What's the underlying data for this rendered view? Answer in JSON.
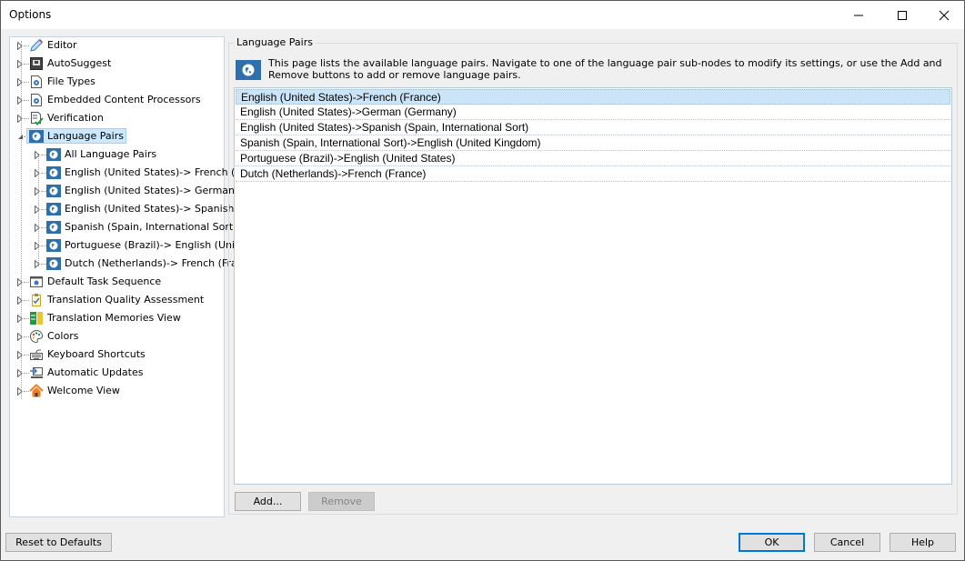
{
  "window": {
    "title": "Options",
    "controls": {
      "minimize": "minimize",
      "maximize": "maximize",
      "close": "close"
    }
  },
  "tree": {
    "items": [
      {
        "label": "Editor",
        "icon": "pencil-icon"
      },
      {
        "label": "AutoSuggest",
        "icon": "autosuggest-icon"
      },
      {
        "label": "File Types",
        "icon": "file-gear-icon"
      },
      {
        "label": "Embedded Content Processors",
        "icon": "file-gear-icon"
      },
      {
        "label": "Verification",
        "icon": "checklist-icon"
      },
      {
        "label": "Language Pairs",
        "icon": "globe-icon",
        "selected": true,
        "expanded": true,
        "children": [
          {
            "label": "All Language Pairs",
            "icon": "globe-icon"
          },
          {
            "label": "English (United States)-> French (F",
            "icon": "globe-icon"
          },
          {
            "label": "English (United States)-> German (",
            "icon": "globe-icon"
          },
          {
            "label": "English (United States)-> Spanish (",
            "icon": "globe-icon"
          },
          {
            "label": "Spanish (Spain, International Sort)",
            "icon": "globe-icon"
          },
          {
            "label": "Portuguese (Brazil)-> English (Unit",
            "icon": "globe-icon"
          },
          {
            "label": "Dutch (Netherlands)-> French (Fra",
            "icon": "globe-icon"
          }
        ]
      },
      {
        "label": "Default Task Sequence",
        "icon": "window-gear-icon"
      },
      {
        "label": "Translation Quality Assessment",
        "icon": "clipboard-check-icon"
      },
      {
        "label": "Translation Memories View",
        "icon": "tm-view-icon"
      },
      {
        "label": "Colors",
        "icon": "palette-icon"
      },
      {
        "label": "Keyboard Shortcuts",
        "icon": "keyboard-icon"
      },
      {
        "label": "Automatic Updates",
        "icon": "computer-update-icon"
      },
      {
        "label": "Welcome View",
        "icon": "home-icon"
      }
    ]
  },
  "panel": {
    "group_title": "Language Pairs",
    "info_text": "This page lists the available language pairs. Navigate to one of the language pair sub-nodes to modify its settings, or use the Add and Remove buttons to add or remove language pairs.",
    "language_pairs": [
      "English (United States)->French (France)",
      "English (United States)->German (Germany)",
      "English (United States)->Spanish (Spain, International Sort)",
      "Spanish (Spain, International Sort)->English (United Kingdom)",
      "Portuguese (Brazil)->English (United States)",
      "Dutch (Netherlands)->French (France)"
    ],
    "selected_index": 0,
    "add_label": "Add...",
    "remove_label": "Remove"
  },
  "footer": {
    "reset_label": "Reset to Defaults",
    "ok_label": "OK",
    "cancel_label": "Cancel",
    "help_label": "Help"
  },
  "colors": {
    "selection": "#cce8ff",
    "accent": "#0078d7",
    "globe_blue": "#2e6fad"
  }
}
